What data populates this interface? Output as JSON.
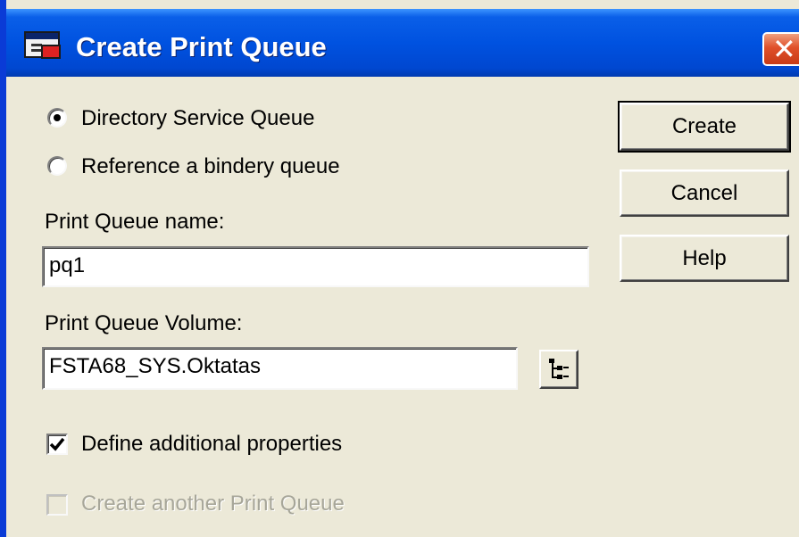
{
  "window": {
    "title": "Create Print Queue",
    "close_glyph": "✕"
  },
  "options": {
    "directory_service_queue": {
      "label": "Directory Service Queue",
      "selected": true
    },
    "reference_bindery_queue": {
      "label": "Reference a bindery queue",
      "selected": false
    }
  },
  "fields": {
    "queue_name": {
      "label": "Print Queue name:",
      "value": "pq1"
    },
    "queue_volume": {
      "label": "Print Queue Volume:",
      "value": "FSTA68_SYS.Oktatas"
    }
  },
  "checkboxes": {
    "define_additional": {
      "label": "Define additional properties",
      "checked": true
    },
    "create_another": {
      "label": "Create another Print Queue",
      "checked": false,
      "disabled": true
    }
  },
  "buttons": {
    "create": "Create",
    "cancel": "Cancel",
    "help": "Help"
  },
  "icons": {
    "window": "print-queue-window-icon",
    "browse": "tree-browse-icon",
    "close": "close-icon"
  },
  "colors": {
    "titlebar": "#0052e0",
    "dialog_face": "#ece9d8",
    "close_button": "#e0502a",
    "disabled_text": "#a7a699"
  }
}
